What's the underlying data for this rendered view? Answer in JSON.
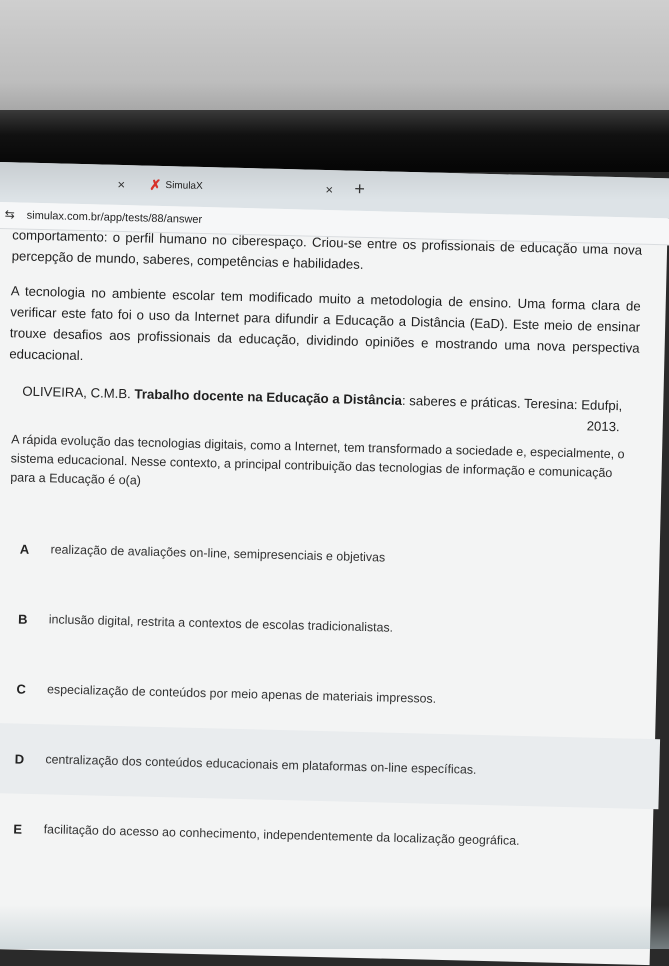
{
  "browser": {
    "tabs": [
      {
        "close": "×"
      },
      {
        "favicon": "✗",
        "title": "SimulaX",
        "close": "×"
      }
    ],
    "new_tab": "+",
    "address_icon": "⇆",
    "url": "simulax.com.br/app/tests/88/answer"
  },
  "passage": {
    "para1": "comportamento: o perfil humano no ciberespaço. Criou-se entre os profissionais de educação uma nova percepção de mundo, saberes, competências e habilidades.",
    "para2": "A tecnologia no ambiente escolar tem modificado muito a metodologia de ensino. Uma forma clara de verificar este fato foi o uso da Internet para difundir a Educação a Distância (EaD). Este meio de ensinar trouxe desafios aos profissionais da educação, dividindo opiniões e mostrando uma nova perspectiva educacional.",
    "citation_author": "OLIVEIRA, C.M.B.",
    "citation_title": "Trabalho docente na Educação a Distância",
    "citation_rest": ": saberes e práticas. Teresina: Edufpi,",
    "citation_year": "2013."
  },
  "question": {
    "text": "A rápida evolução das tecnologias digitais, como a Internet, tem transformado a sociedade e, especialmente, o sistema educacional. Nesse contexto, a principal contribuição das tecnologias de informação e comunicação para a Educação é o(a)",
    "options": [
      {
        "letter": "A",
        "text": "realização de avaliações on-line, semipresenciais e objetivas"
      },
      {
        "letter": "B",
        "text": "inclusão digital, restrita a contextos de escolas tradicionalistas."
      },
      {
        "letter": "C",
        "text": "especialização de conteúdos por meio apenas de materiais impressos."
      },
      {
        "letter": "D",
        "text": "centralização dos conteúdos educacionais em plataformas on-line específicas."
      },
      {
        "letter": "E",
        "text": "facilitação do acesso ao conhecimento, independentemente da localização geográfica."
      }
    ]
  },
  "colors": {
    "tabbar": "#dde3e7",
    "favicon": "#e0332c",
    "page_bg": "#f3f4f4",
    "highlight_option": "#e9ecee"
  }
}
